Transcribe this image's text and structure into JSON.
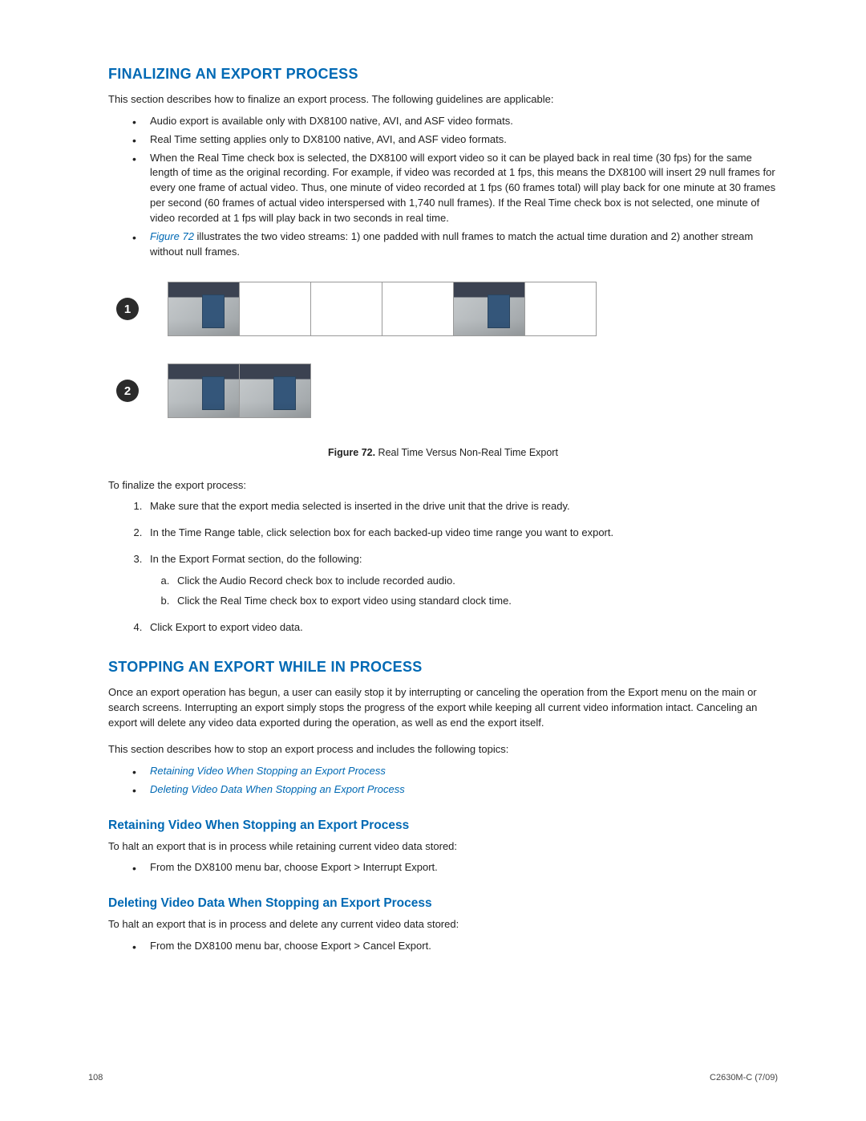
{
  "section1": {
    "heading": "FINALIZING AN EXPORT PROCESS",
    "intro": "This section describes how to finalize an export process. The following guidelines are applicable:",
    "bullets": [
      "Audio export is available only with DX8100 native, AVI, and ASF video formats.",
      "Real Time setting applies only to DX8100 native, AVI, and ASF video formats.",
      "When the Real Time check box is selected, the DX8100 will export video so it can be played back in real time (30 fps) for the same length of time as the original recording. For example, if video was recorded at 1 fps, this means the DX8100 will insert 29 null frames for every one frame of actual video. Thus, one minute of video recorded at 1 fps (60 frames total) will play back for one minute at 30 frames per second (60 frames of actual video interspersed with 1,740 null frames). If the Real Time check box is not selected, one minute of video recorded at 1 fps will play back in two seconds in real time."
    ],
    "figref_label": "Figure 72",
    "figref_rest": " illustrates the two video streams: 1) one padded with null frames to match the actual time duration and 2) another stream without null frames.",
    "fig_badge_1": "1",
    "fig_badge_2": "2",
    "fig_caption_bold": "Figure 72.",
    "fig_caption_rest": "  Real Time Versus Non-Real Time Export",
    "after_fig": "To finalize the export process:",
    "steps": [
      "Make sure that the export media selected is inserted in the drive unit that the drive is ready.",
      "In the Time Range table, click selection box for each backed-up video time range you want to export.",
      "In the Export Format section, do the following:",
      "Click Export to export video data."
    ],
    "substeps": [
      "Click the Audio Record check box to include recorded audio.",
      "Click the Real Time check box to export video using standard clock time."
    ]
  },
  "section2": {
    "heading": "STOPPING AN EXPORT WHILE IN PROCESS",
    "p1": "Once an export operation has begun, a user can easily stop it by interrupting or canceling the operation from the Export menu on the main or search screens. Interrupting an export simply stops the progress of the export while keeping all current video information intact. Canceling an export will delete any video data exported during the operation, as well as end the export itself.",
    "p2": "This section describes how to stop an export process and includes the following topics:",
    "links": [
      "Retaining Video When Stopping an Export Process",
      "Deleting Video Data When Stopping an Export Process"
    ],
    "sub1_heading": "Retaining Video When Stopping an Export Process",
    "sub1_p": "To halt an export that is in process while retaining current video data stored:",
    "sub1_bullet": "From the DX8100 menu bar, choose Export > Interrupt Export.",
    "sub2_heading": "Deleting Video Data When Stopping an Export Process",
    "sub2_p": "To halt an export that is in process and delete any current video data stored:",
    "sub2_bullet": "From the DX8100 menu bar, choose Export > Cancel Export."
  },
  "footer": {
    "page": "108",
    "doc": "C2630M-C (7/09)"
  }
}
